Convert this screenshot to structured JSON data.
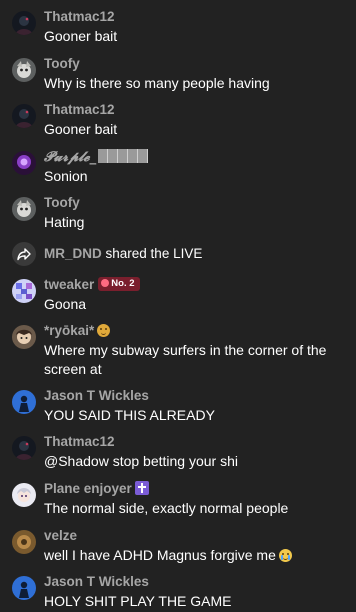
{
  "messages": [
    {
      "user": "Thatmac12",
      "text": "Gooner bait",
      "avatar_icon": "dark-silhouette-avatar"
    },
    {
      "user": "Toofy",
      "text": "Why is there so many people having",
      "avatar_icon": "grey-creature-avatar"
    },
    {
      "user": "Thatmac12",
      "text": "Gooner bait",
      "avatar_icon": "dark-silhouette-avatar"
    },
    {
      "user": "𝓟𝓾𝓻𝓹𝓵𝓮_",
      "text": "Sonion",
      "avatar_icon": "purple-avatar"
    },
    {
      "user": "Toofy",
      "text": "Hating",
      "avatar_icon": "grey-creature-avatar"
    },
    {
      "user": "tweaker",
      "badge": "No. 2",
      "text": "Goona",
      "avatar_icon": "blue-pixel-avatar"
    },
    {
      "user": "*ryōkai*",
      "text": "Where my subway surfers in the corner of the screen at",
      "avatar_icon": "anime-avatar"
    },
    {
      "user": "Jason T Wickles",
      "text": "YOU SAID THIS ALREADY",
      "avatar_icon": "blue-figure-avatar"
    },
    {
      "user": "Thatmac12",
      "text": "@Shadow stop betting your shi",
      "avatar_icon": "dark-silhouette-avatar"
    },
    {
      "user": "Plane enjoyer",
      "text": "The normal side, exactly normal people",
      "avatar_icon": "white-anime-avatar"
    },
    {
      "user": "velze",
      "text": "well I have ADHD Magnus forgive me",
      "avatar_icon": "brown-avatar"
    },
    {
      "user": "Jason T Wickles",
      "text": "HOLY SHIT PLAY THE GAME",
      "avatar_icon": "blue-figure-avatar"
    }
  ],
  "share_event": {
    "user": "MR_DND",
    "text": "shared the LIVE",
    "icon": "share-arrow-icon"
  },
  "colors": {
    "background": "#222222",
    "username": "#a6a6a6",
    "message": "#ffffff",
    "badge_bg": "#7a1f2d"
  }
}
